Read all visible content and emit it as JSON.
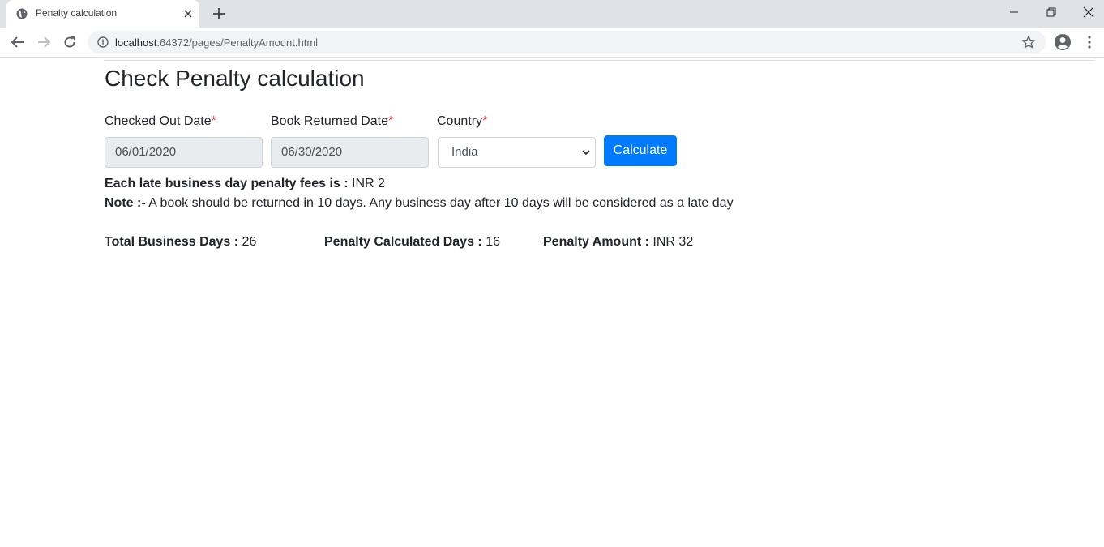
{
  "browser": {
    "tab_title": "Penalty calculation",
    "url_host": "localhost",
    "url_path": ":64372/pages/PenaltyAmount.html"
  },
  "icons": {
    "favicon": "globe-icon",
    "tab_close": "close-icon",
    "new_tab": "plus-icon",
    "back": "arrow-left-icon",
    "forward": "arrow-right-icon",
    "reload": "reload-icon",
    "site_info": "info-icon",
    "bookmark": "star-icon",
    "profile": "account-circle-icon",
    "menu": "kebab-menu-icon"
  },
  "colors": {
    "primary": "#007bff",
    "required": "#dc3545",
    "disabled_input_bg": "#e9ecef"
  },
  "page": {
    "title": "Check Penalty calculation",
    "form": {
      "checked_out_label": "Checked Out Date",
      "checked_out_value": "06/01/2020",
      "returned_label": "Book Returned Date",
      "returned_value": "06/30/2020",
      "country_label": "Country",
      "country_selected": "India",
      "required_mark": "*",
      "calculate_label": "Calculate"
    },
    "fee_label": "Each late business day penalty fees is :",
    "fee_value": "INR 2",
    "note_label": "Note :-",
    "note_text": "A book should be returned in 10 days. Any business day after 10 days will be considered as a late day",
    "results": {
      "total_label": "Total Business Days :",
      "total_value": "26",
      "penalty_days_label": "Penalty Calculated Days :",
      "penalty_days_value": "16",
      "amount_label": "Penalty Amount :",
      "amount_value": "INR 32"
    }
  }
}
